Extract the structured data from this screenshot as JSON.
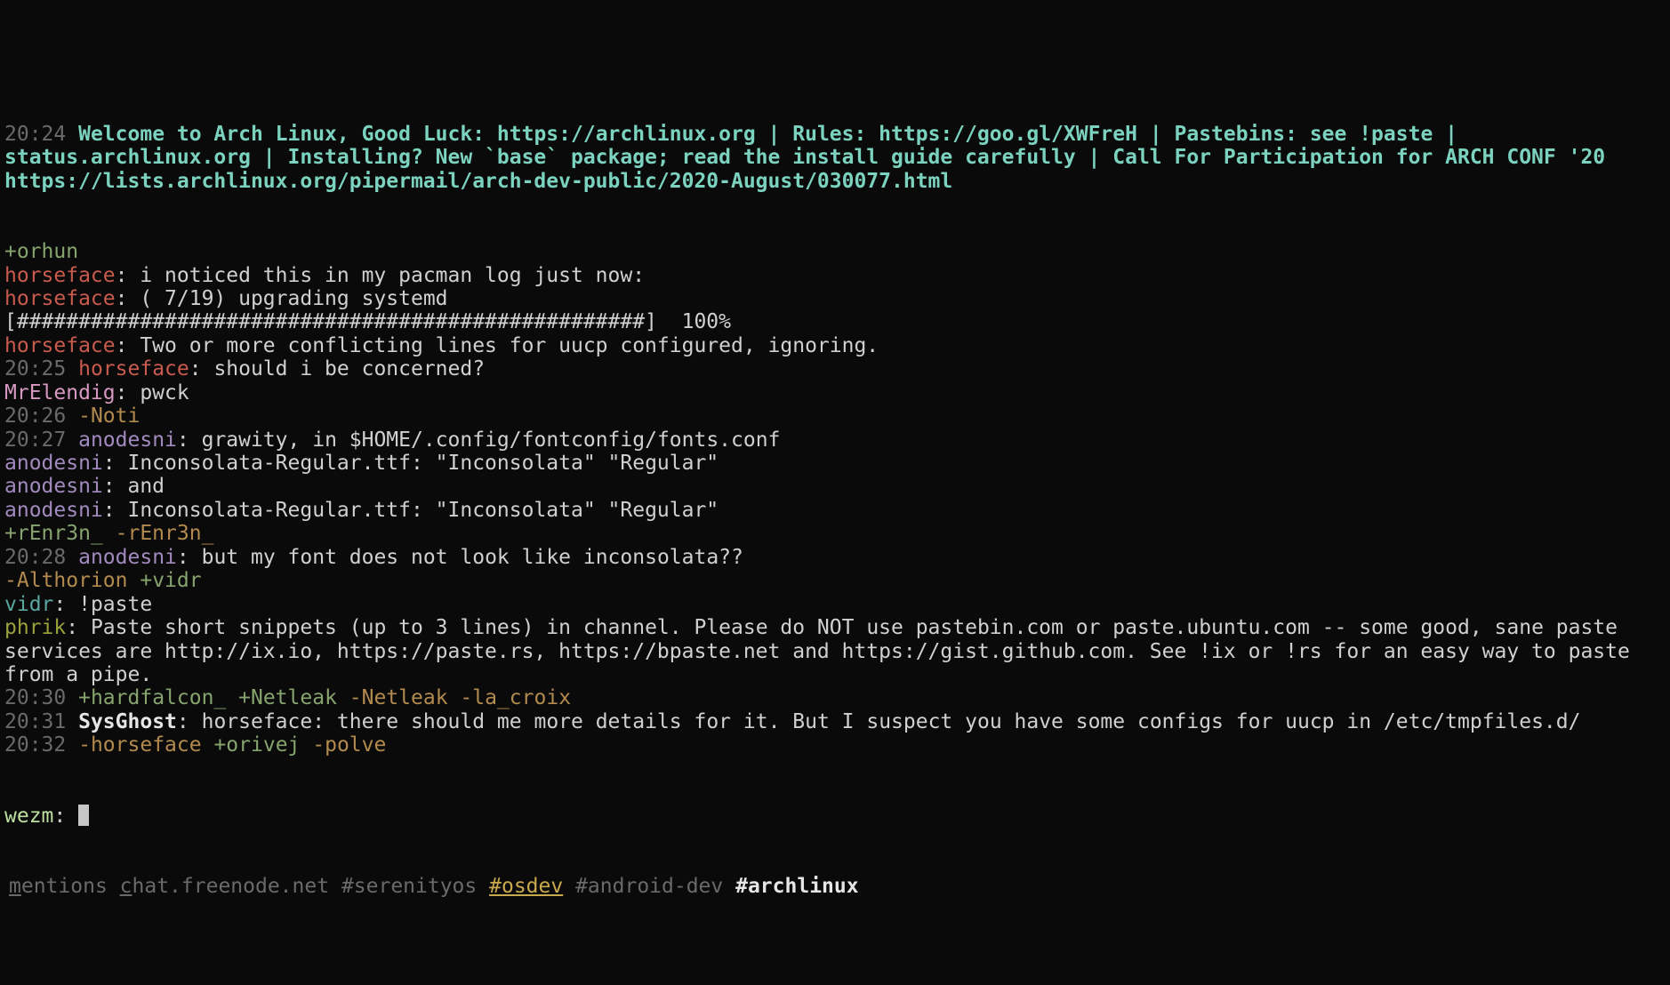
{
  "topic": {
    "time": "20:24",
    "text": "Welcome to Arch Linux, Good Luck: https://archlinux.org | Rules: https://goo.gl/XWFreH | Pastebins: see !paste | status.archlinux.org | Installing? New `base` package; read the install guide carefully | Call For Participation for ARCH CONF '20 https://lists.archlinux.org/pipermail/arch-dev-public/2020-August/030077.html"
  },
  "lines": [
    {
      "type": "join",
      "text": "+orhun"
    },
    {
      "type": "msg",
      "nick": "horseface",
      "nickColor": "nick-red",
      "text": "i noticed this in my pacman log just now:"
    },
    {
      "type": "msg",
      "nick": "horseface",
      "nickColor": "nick-red",
      "text": "( 7/19) upgrading systemd"
    },
    {
      "type": "raw",
      "text": "[###################################################]  100%"
    },
    {
      "type": "msg",
      "nick": "horseface",
      "nickColor": "nick-red",
      "text": "Two or more conflicting lines for uucp configured, ignoring."
    },
    {
      "type": "msg",
      "ts": "20:25",
      "nick": "horseface",
      "nickColor": "nick-red",
      "text": "should i be concerned?"
    },
    {
      "type": "msg",
      "nick": "MrElendig",
      "nickColor": "nick-pink",
      "text": "pwck"
    },
    {
      "type": "joinpart",
      "ts": "20:26",
      "parts": [
        {
          "kind": "part",
          "text": "-Noti"
        }
      ]
    },
    {
      "type": "msg",
      "ts": "20:27",
      "nick": "anodesni",
      "nickColor": "nick-purple",
      "text": "grawity, in $HOME/.config/fontconfig/fonts.conf"
    },
    {
      "type": "msg",
      "nick": "anodesni",
      "nickColor": "nick-purple",
      "text": "Inconsolata-Regular.ttf: \"Inconsolata\" \"Regular\""
    },
    {
      "type": "msg",
      "nick": "anodesni",
      "nickColor": "nick-purple",
      "text": "and"
    },
    {
      "type": "msg",
      "nick": "anodesni",
      "nickColor": "nick-purple",
      "text": "Inconsolata-Regular.ttf: \"Inconsolata\" \"Regular\""
    },
    {
      "type": "joinpart",
      "parts": [
        {
          "kind": "join",
          "text": "+rEnr3n_"
        },
        {
          "kind": "part",
          "text": "-rEnr3n_"
        }
      ]
    },
    {
      "type": "msg",
      "ts": "20:28",
      "nick": "anodesni",
      "nickColor": "nick-purple",
      "text": "but my font does not look like inconsolata??"
    },
    {
      "type": "joinpart",
      "parts": [
        {
          "kind": "part",
          "text": "-Althorion"
        },
        {
          "kind": "join",
          "text": "+vidr"
        }
      ]
    },
    {
      "type": "msg",
      "nick": "vidr",
      "nickColor": "nick-teal",
      "text": "!paste"
    },
    {
      "type": "msg",
      "nick": "phrik",
      "nickColor": "nick-olive",
      "text": "Paste short snippets (up to 3 lines) in channel. Please do NOT use pastebin.com or paste.ubuntu.com -- some good, sane paste services are http://ix.io, https://paste.rs, https://bpaste.net and https://gist.github.com. See !ix or !rs for an easy way to paste from a pipe."
    },
    {
      "type": "joinpart",
      "ts": "20:30",
      "parts": [
        {
          "kind": "join",
          "text": "+hardfalcon_"
        },
        {
          "kind": "join",
          "text": "+Netleak"
        },
        {
          "kind": "part",
          "text": "-Netleak"
        },
        {
          "kind": "part",
          "text": "-la_croix"
        }
      ]
    },
    {
      "type": "msg",
      "ts": "20:31",
      "nick": "SysGhost",
      "nickColor": "nick-white",
      "text": "horseface: there should me more details for it. But I suspect you have some configs for uucp in /etc/tmpfiles.d/"
    },
    {
      "type": "joinpart",
      "ts": "20:32",
      "parts": [
        {
          "kind": "part",
          "text": "-horseface"
        },
        {
          "kind": "join",
          "text": "+orivej"
        },
        {
          "kind": "part",
          "text": "-polve"
        }
      ]
    }
  ],
  "prompt": {
    "nick": "wezm",
    "sep": ":"
  },
  "bar": {
    "mentions": "mentions",
    "server": "chat.freenode.net",
    "channels": [
      {
        "name": "#serenityos",
        "state": "normal"
      },
      {
        "name": "#osdev",
        "state": "hl"
      },
      {
        "name": "#android-dev",
        "state": "normal"
      },
      {
        "name": "#archlinux",
        "state": "active"
      }
    ]
  }
}
